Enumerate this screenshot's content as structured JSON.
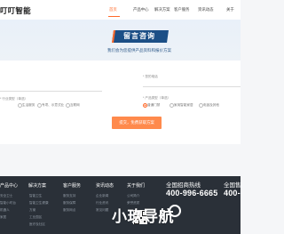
{
  "header": {
    "logo": "叮叮智能",
    "nav": [
      {
        "label": "首页",
        "active": true
      },
      {
        "label": "产品中心",
        "active": false
      },
      {
        "label": "解决方案",
        "active": false
      },
      {
        "label": "客户服务",
        "active": false
      },
      {
        "label": "资讯动态",
        "active": false
      },
      {
        "label": "关于",
        "active": false
      }
    ]
  },
  "hero": {
    "title": "留言咨询",
    "subtitle": "我们会为您提供产品资料和报价方案"
  },
  "form": {
    "left_label_1": "",
    "left_label_2": "",
    "phone_label": "* 您的电话",
    "industry_label": "* 行业类型（单选）",
    "product_label": "* 产品类型（单选）",
    "industry_options": [
      "",
      "生活服务",
      "专项、示意式业",
      "互联网"
    ],
    "product_options": [
      "普通门禁",
      "家用智能家居",
      "电锁及其他"
    ],
    "submit_label": "提交，免费获取方案",
    "colors": {
      "accent": "#ff6a2a",
      "navy": "#1c4f86"
    }
  },
  "footer": {
    "columns": [
      {
        "title": "产品中心",
        "items": [
          "安全卫士",
          "智能小时台",
          "机器人",
          "家居"
        ]
      },
      {
        "title": "解决方案",
        "items": [
          "智能卫生",
          "智能卫生健康",
          "方案",
          "工业园区",
          "医疗及社区"
        ]
      },
      {
        "title": "客户服务",
        "items": [
          "服务支持",
          "服务保障",
          "服务网点"
        ]
      },
      {
        "title": "资讯动态",
        "items": [
          "企业新闻",
          "行业资讯",
          "常见问题"
        ]
      },
      {
        "title": "关于我们",
        "items": [
          "公司简介",
          "荣誉资质",
          "联系我们"
        ]
      }
    ],
    "hotline_label": "全国招商热线",
    "hotline_number": "400-996-6665",
    "hotline_label_2": "全国售",
    "hotline_number_2": "400-",
    "watermark": "小玖导航"
  }
}
